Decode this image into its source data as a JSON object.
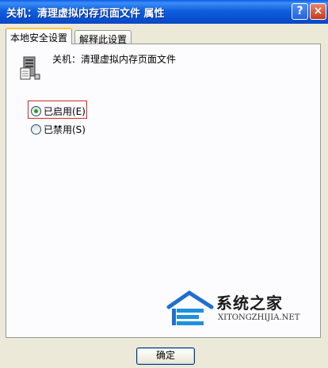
{
  "window": {
    "title": "关机：清理虚拟内存页面文件 属性",
    "help_label": "?",
    "close_label": "×"
  },
  "tabs": [
    {
      "label": "本地安全设置",
      "active": true
    },
    {
      "label": "解释此设置",
      "active": false
    }
  ],
  "policy": {
    "name": "关机：清理虚拟内存页面文件"
  },
  "options": [
    {
      "label": "已启用(E)",
      "checked": true,
      "highlighted": true
    },
    {
      "label": "已禁用(S)",
      "checked": false,
      "highlighted": false
    }
  ],
  "watermark": {
    "title": "系统之家",
    "url": "XITONGZHIJIA.NET"
  },
  "footer": {
    "ok_label": "确定"
  },
  "colors": {
    "titlebar": "#0a5ce6",
    "highlight_border": "#d62828",
    "dialog_bg": "#ece9d8"
  }
}
